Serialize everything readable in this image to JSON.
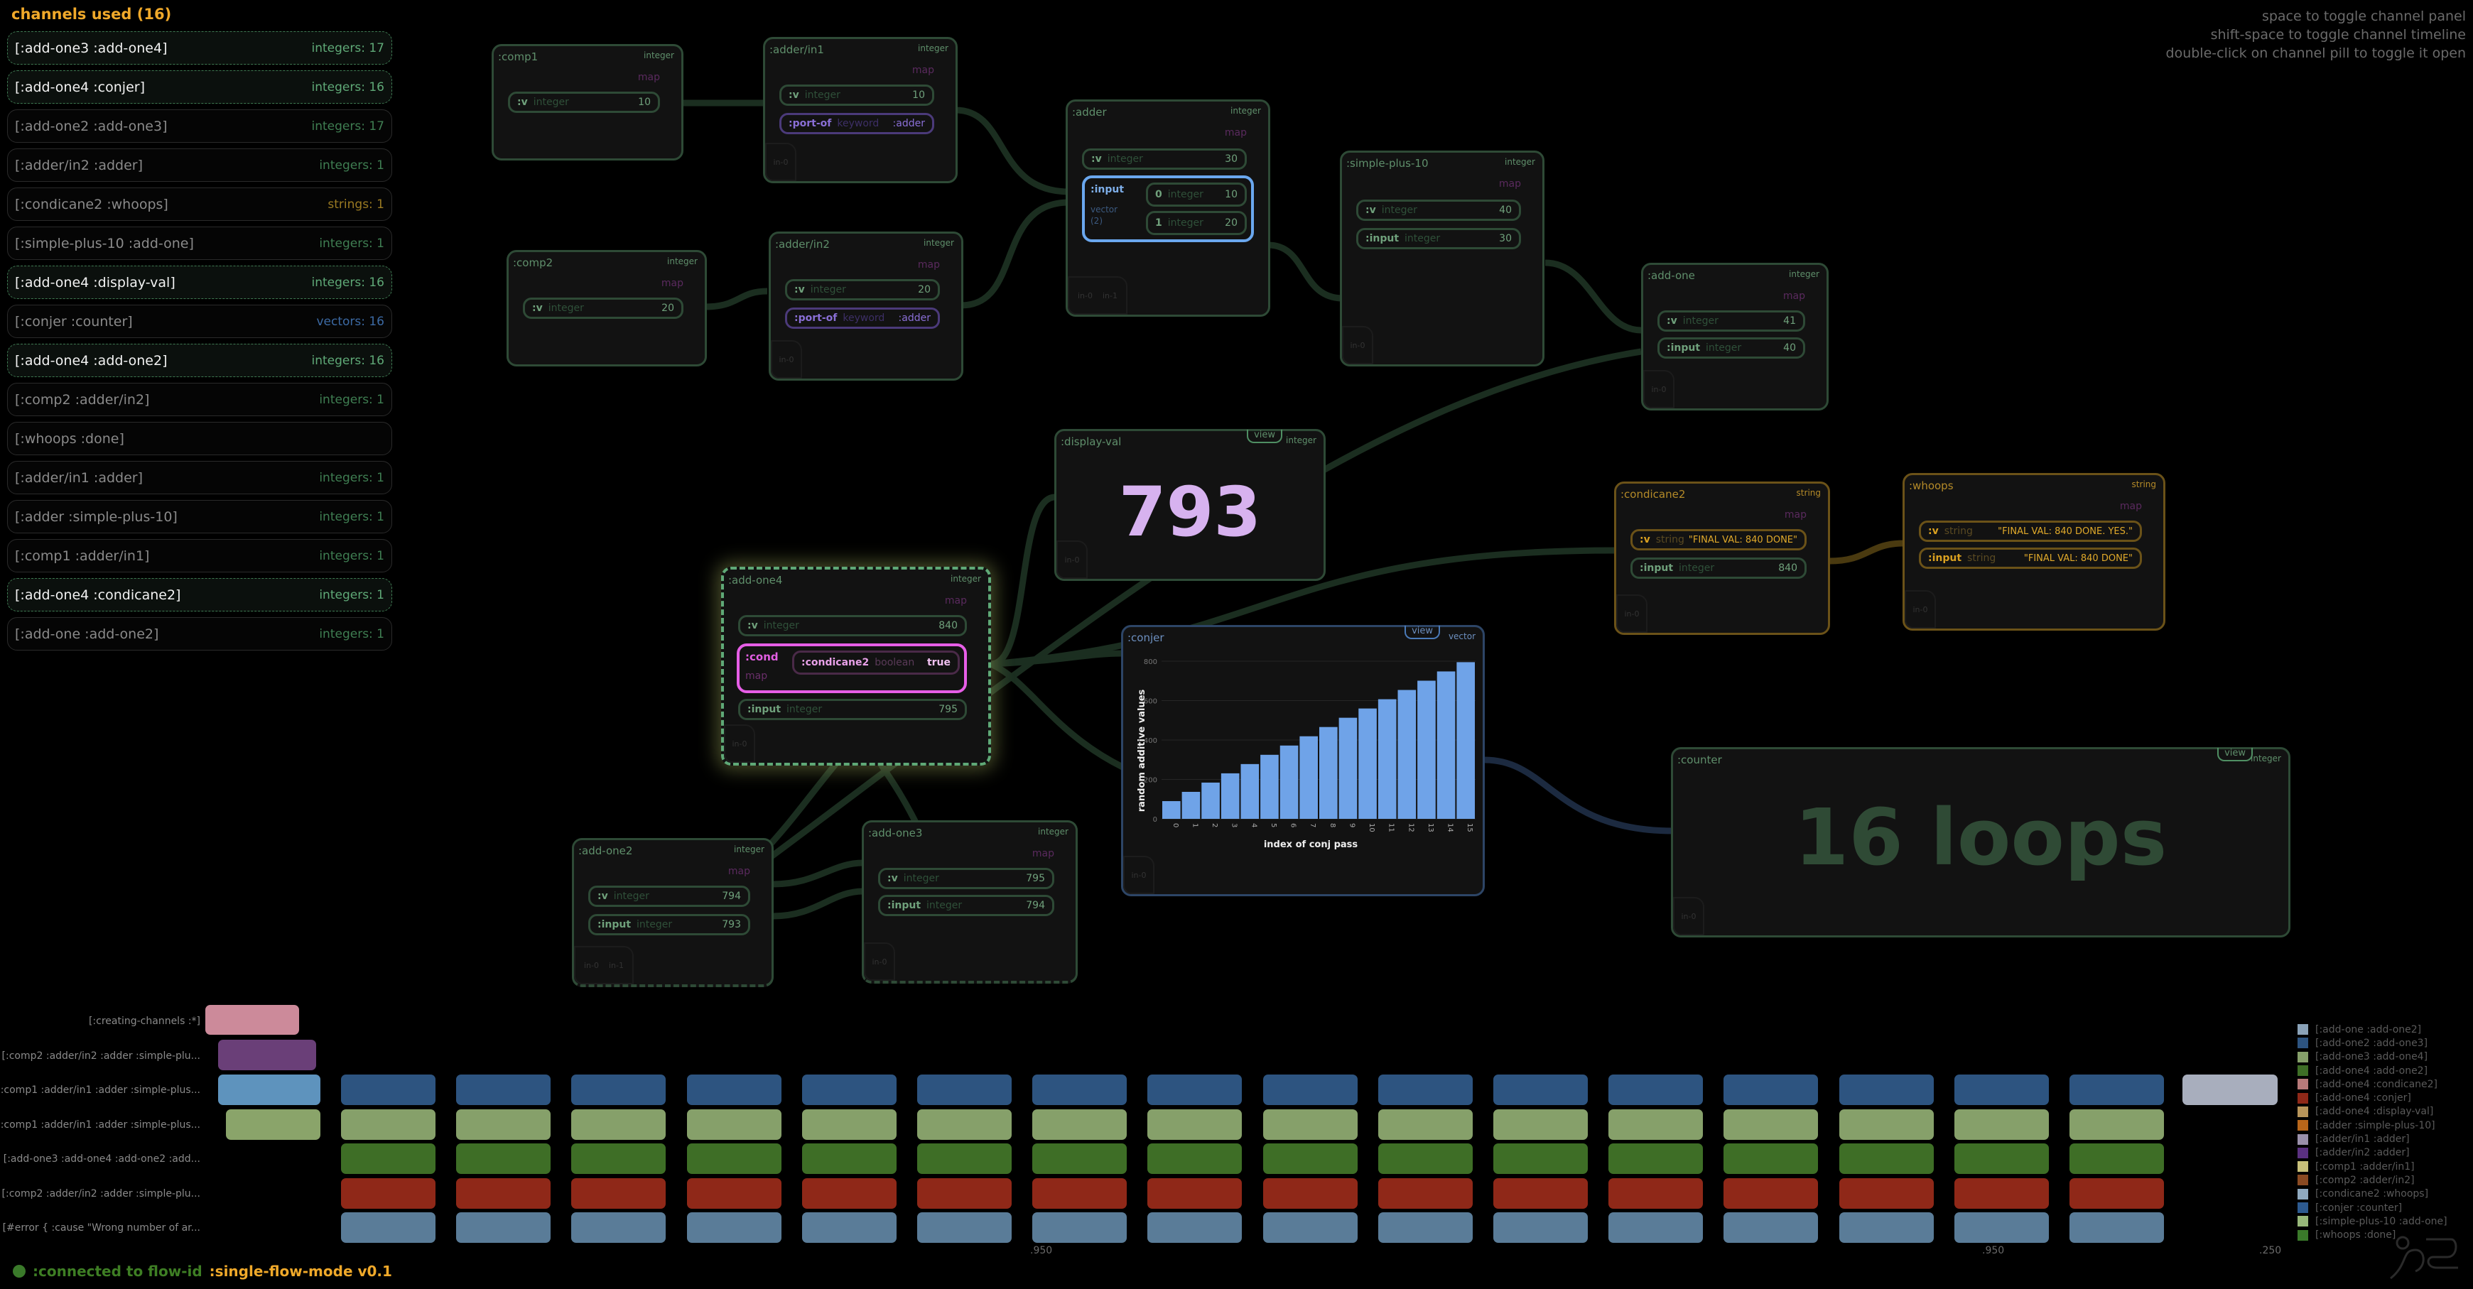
{
  "channel_panel": {
    "title": "channels used (16)",
    "channels": [
      {
        "name": "[:add-one3 :add-one4]",
        "count": "integers: 17",
        "active": true,
        "kind": "int"
      },
      {
        "name": "[:add-one4 :conjer]",
        "count": "integers: 16",
        "active": true,
        "kind": "int"
      },
      {
        "name": "[:add-one2 :add-one3]",
        "count": "integers: 17",
        "active": false,
        "kind": "int"
      },
      {
        "name": "[:adder/in2 :adder]",
        "count": "integers: 1",
        "active": false,
        "kind": "int"
      },
      {
        "name": "[:condicane2 :whoops]",
        "count": "strings: 1",
        "active": false,
        "kind": "str"
      },
      {
        "name": "[:simple-plus-10 :add-one]",
        "count": "integers: 1",
        "active": false,
        "kind": "int"
      },
      {
        "name": "[:add-one4 :display-val]",
        "count": "integers: 16",
        "active": true,
        "kind": "int"
      },
      {
        "name": "[:conjer :counter]",
        "count": "vectors: 16",
        "active": false,
        "kind": "vec"
      },
      {
        "name": "[:add-one4 :add-one2]",
        "count": "integers: 16",
        "active": true,
        "kind": "int"
      },
      {
        "name": "[:comp2 :adder/in2]",
        "count": "integers: 1",
        "active": false,
        "kind": "int"
      },
      {
        "name": "[:whoops :done]",
        "count": "",
        "active": false,
        "kind": "int"
      },
      {
        "name": "[:adder/in1 :adder]",
        "count": "integers: 1",
        "active": false,
        "kind": "int"
      },
      {
        "name": "[:adder :simple-plus-10]",
        "count": "integers: 1",
        "active": false,
        "kind": "int"
      },
      {
        "name": "[:comp1 :adder/in1]",
        "count": "integers: 1",
        "active": false,
        "kind": "int"
      },
      {
        "name": "[:add-one4 :condicane2]",
        "count": "integers: 1",
        "active": true,
        "kind": "int"
      },
      {
        "name": "[:add-one :add-one2]",
        "count": "integers: 1",
        "active": false,
        "kind": "int"
      }
    ]
  },
  "hints": [
    "space to toggle channel panel",
    "shift-space to toggle channel timeline",
    "double-click on channel pill to toggle it open"
  ],
  "nodes": {
    "comp1": {
      "title": ":comp1",
      "type": "integer",
      "map": "map",
      "v": {
        "key": ":v",
        "type": "integer",
        "value": "10"
      }
    },
    "adder_in1": {
      "title": ":adder/in1",
      "type": "integer",
      "map": "map",
      "v": {
        "key": ":v",
        "type": "integer",
        "value": "10"
      },
      "port": {
        "key": ":port-of",
        "type": "keyword",
        "value": ":adder"
      },
      "in": [
        "in-0"
      ]
    },
    "comp2": {
      "title": ":comp2",
      "type": "integer",
      "map": "map",
      "v": {
        "key": ":v",
        "type": "integer",
        "value": "20"
      }
    },
    "adder_in2": {
      "title": ":adder/in2",
      "type": "integer",
      "map": "map",
      "v": {
        "key": ":v",
        "type": "integer",
        "value": "20"
      },
      "port": {
        "key": ":port-of",
        "type": "keyword",
        "value": ":adder"
      },
      "in": [
        "in-0"
      ]
    },
    "adder": {
      "title": ":adder",
      "type": "integer",
      "map": "map",
      "v": {
        "key": ":v",
        "type": "integer",
        "value": "30"
      },
      "input": {
        "key": ":input",
        "type": "vector",
        "count": "(2)",
        "items": [
          {
            "key": "0",
            "type": "integer",
            "value": "10"
          },
          {
            "key": "1",
            "type": "integer",
            "value": "20"
          }
        ]
      },
      "in": [
        "in-0",
        "in-1"
      ]
    },
    "simple_plus_10": {
      "title": ":simple-plus-10",
      "type": "integer",
      "map": "map",
      "v": {
        "key": ":v",
        "type": "integer",
        "value": "40"
      },
      "input": {
        "key": ":input",
        "type": "integer",
        "value": "30"
      },
      "in": [
        "in-0"
      ]
    },
    "add_one": {
      "title": ":add-one",
      "type": "integer",
      "map": "map",
      "v": {
        "key": ":v",
        "type": "integer",
        "value": "41"
      },
      "input": {
        "key": ":input",
        "type": "integer",
        "value": "40"
      },
      "in": [
        "in-0"
      ]
    },
    "display_val": {
      "title": ":display-val",
      "type": "integer",
      "view": "view",
      "value": "793",
      "in": [
        "in-0"
      ]
    },
    "condicane2": {
      "title": ":condicane2",
      "type": "string",
      "map": "map",
      "v": {
        "key": ":v",
        "type": "string",
        "value": "\"FINAL VAL: 840 DONE\""
      },
      "input": {
        "key": ":input",
        "type": "integer",
        "value": "840"
      },
      "in": [
        "in-0"
      ]
    },
    "whoops": {
      "title": ":whoops",
      "type": "string",
      "map": "map",
      "v": {
        "key": ":v",
        "type": "string",
        "value": "\"FINAL VAL: 840 DONE. YES.\""
      },
      "input": {
        "key": ":input",
        "type": "string",
        "value": "\"FINAL VAL: 840 DONE\""
      },
      "in": [
        "in-0"
      ]
    },
    "add_one4": {
      "title": ":add-one4",
      "type": "integer",
      "map": "map",
      "v": {
        "key": ":v",
        "type": "integer",
        "value": "840"
      },
      "cond": {
        "key": ":cond",
        "type": "map",
        "inner_key": ":condicane2",
        "inner_type": "boolean",
        "inner_value": "true"
      },
      "input": {
        "key": ":input",
        "type": "integer",
        "value": "795"
      },
      "in": [
        "in-0"
      ]
    },
    "conjer": {
      "title": ":conjer",
      "type": "vector",
      "view": "view",
      "in": [
        "in-0"
      ]
    },
    "add_one2": {
      "title": ":add-one2",
      "type": "integer",
      "map": "map",
      "v": {
        "key": ":v",
        "type": "integer",
        "value": "794"
      },
      "input": {
        "key": ":input",
        "type": "integer",
        "value": "793"
      },
      "in": [
        "in-0",
        "in-1"
      ]
    },
    "add_one3": {
      "title": ":add-one3",
      "type": "integer",
      "map": "map",
      "v": {
        "key": ":v",
        "type": "integer",
        "value": "795"
      },
      "input": {
        "key": ":input",
        "type": "integer",
        "value": "794"
      },
      "in": [
        "in-0"
      ]
    },
    "counter": {
      "title": ":counter",
      "type": "integer",
      "view": "view",
      "value": "16 loops",
      "in": [
        "in-0"
      ]
    }
  },
  "chart_data": {
    "type": "bar",
    "title": "",
    "xlabel": "index of conj pass",
    "ylabel": "random additive values",
    "categories": [
      "0",
      "1",
      "2",
      "3",
      "4",
      "5",
      "6",
      "7",
      "8",
      "9",
      "10",
      "11",
      "12",
      "13",
      "14",
      "15"
    ],
    "values": [
      90,
      137,
      184,
      231,
      278,
      325,
      372,
      419,
      466,
      513,
      560,
      607,
      654,
      701,
      748,
      795
    ],
    "ylim": [
      0,
      800
    ],
    "yticks": [
      0,
      200,
      400,
      600,
      800
    ],
    "grid": true,
    "color": "#6fa3e8"
  },
  "timeline": {
    "rows": [
      {
        "label": "[:creating-channels :*]"
      },
      {
        "label": "[:comp2 :adder/in2 :adder :simple-plu..."
      },
      {
        "label": "[:comp1 :adder/in1 :adder :simple-plus..."
      },
      {
        "label": "[:comp1 :adder/in1 :adder :simple-plus..."
      },
      {
        "label": "[:add-one3 :add-one4 :add-one2 :add..."
      },
      {
        "label": "[:comp2 :adder/in2 :adder :simple-plu..."
      },
      {
        "label": "[#error {  :cause \"Wrong number of ar..."
      }
    ],
    "loop_row_colors": [
      "#2d5480",
      "#86a06a",
      "#3e6e26",
      "#8f2818",
      "#5a7c98"
    ],
    "loop_count": 16,
    "final_block_color": "#a8aebd",
    "ticks": [
      ".950",
      ".950",
      ".250"
    ]
  },
  "legend": [
    {
      "label": "[:add-one :add-one2]",
      "color": "#8aa2b8"
    },
    {
      "label": "[:add-one2 :add-one3]",
      "color": "#2d5480"
    },
    {
      "label": "[:add-one3 :add-one4]",
      "color": "#86a06a"
    },
    {
      "label": "[:add-one4 :add-one2]",
      "color": "#3e6e26"
    },
    {
      "label": "[:add-one4 :condicane2]",
      "color": "#b87a7a"
    },
    {
      "label": "[:add-one4 :conjer]",
      "color": "#8f2818"
    },
    {
      "label": "[:add-one4 :display-val]",
      "color": "#b8955a"
    },
    {
      "label": "[:adder :simple-plus-10]",
      "color": "#b8661a"
    },
    {
      "label": "[:adder/in1 :adder]",
      "color": "#9a90aa"
    },
    {
      "label": "[:adder/in2 :adder]",
      "color": "#5a3080"
    },
    {
      "label": "[:comp1 :adder/in1]",
      "color": "#c8c07a"
    },
    {
      "label": "[:comp2 :adder/in2]",
      "color": "#8a4a22"
    },
    {
      "label": "[:condicane2 :whoops]",
      "color": "#90aac0"
    },
    {
      "label": "[:conjer :counter]",
      "color": "#2d5a90"
    },
    {
      "label": "[:simple-plus-10 :add-one]",
      "color": "#98b87a"
    },
    {
      "label": "[:whoops :done]",
      "color": "#3a7a2a"
    }
  ],
  "status": {
    "connected": ":connected to flow-id",
    "flow": ":single-flow-mode  v0.1"
  }
}
